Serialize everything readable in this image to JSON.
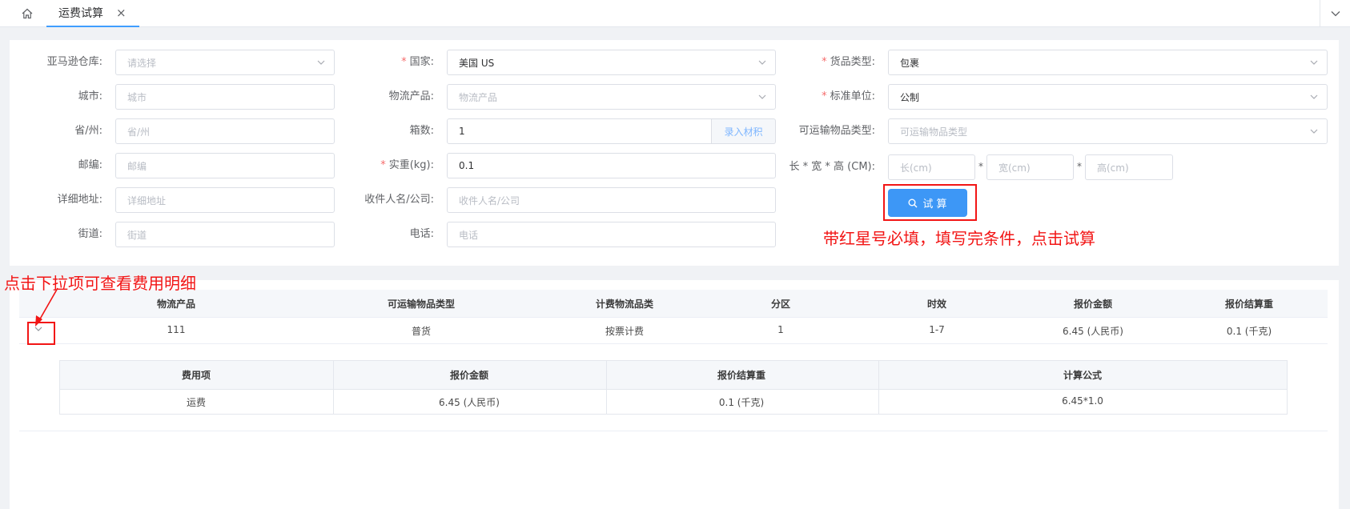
{
  "tabs": {
    "active_label": "运费试算",
    "close_glyph": "×"
  },
  "form": {
    "warehouse": {
      "label": "亚马逊仓库:",
      "placeholder": "请选择"
    },
    "country": {
      "label": "国家:",
      "value": "美国 US"
    },
    "goods_type": {
      "label": "货品类型:",
      "value": "包裹"
    },
    "city": {
      "label": "城市:",
      "placeholder": "城市"
    },
    "logistics_product": {
      "label": "物流产品:",
      "placeholder": "物流产品"
    },
    "unit": {
      "label": "标准单位:",
      "value": "公制"
    },
    "province": {
      "label": "省/州:",
      "placeholder": "省/州"
    },
    "boxes": {
      "label": "箱数:",
      "value": "1",
      "append": "录入材积"
    },
    "transportable_type": {
      "label": "可运输物品类型:",
      "placeholder": "可运输物品类型"
    },
    "zipcode": {
      "label": "邮编:",
      "placeholder": "邮编"
    },
    "weight": {
      "label": "实重(kg):",
      "value": "0.1"
    },
    "dimensions": {
      "label": "长 * 宽 * 高 (CM):",
      "length_ph": "长(cm)",
      "width_ph": "宽(cm)",
      "height_ph": "高(cm)",
      "mul": "*"
    },
    "address": {
      "label": "详细地址:",
      "placeholder": "详细地址"
    },
    "recipient": {
      "label": "收件人名/公司:",
      "placeholder": "收件人名/公司"
    },
    "street": {
      "label": "街道:",
      "placeholder": "街道"
    },
    "phone": {
      "label": "电话:",
      "placeholder": "电话"
    },
    "required_star": "*",
    "calc_button": "试 算"
  },
  "annotations": {
    "required_note": "带红星号必填，填写完条件，点击试算",
    "expand_note": "点击下拉项可查看费用明细"
  },
  "result_table": {
    "columns": [
      "物流产品",
      "可运输物品类型",
      "计费物流品类",
      "分区",
      "时效",
      "报价金额",
      "报价结算重"
    ],
    "rows": [
      [
        "111",
        "普货",
        "按票计费",
        "1",
        "1-7",
        "6.45 (人民币)",
        "0.1 (千克)"
      ]
    ]
  },
  "fee_detail": {
    "columns": [
      "费用项",
      "报价金额",
      "报价结算重",
      "计算公式"
    ],
    "rows": [
      [
        "运费",
        "6.45 (人民币)",
        "0.1 (千克)",
        "6.45*1.0"
      ]
    ]
  },
  "colors": {
    "primary": "#409eff",
    "annotation_red": "#f21515",
    "required_star": "#f56c6c"
  }
}
